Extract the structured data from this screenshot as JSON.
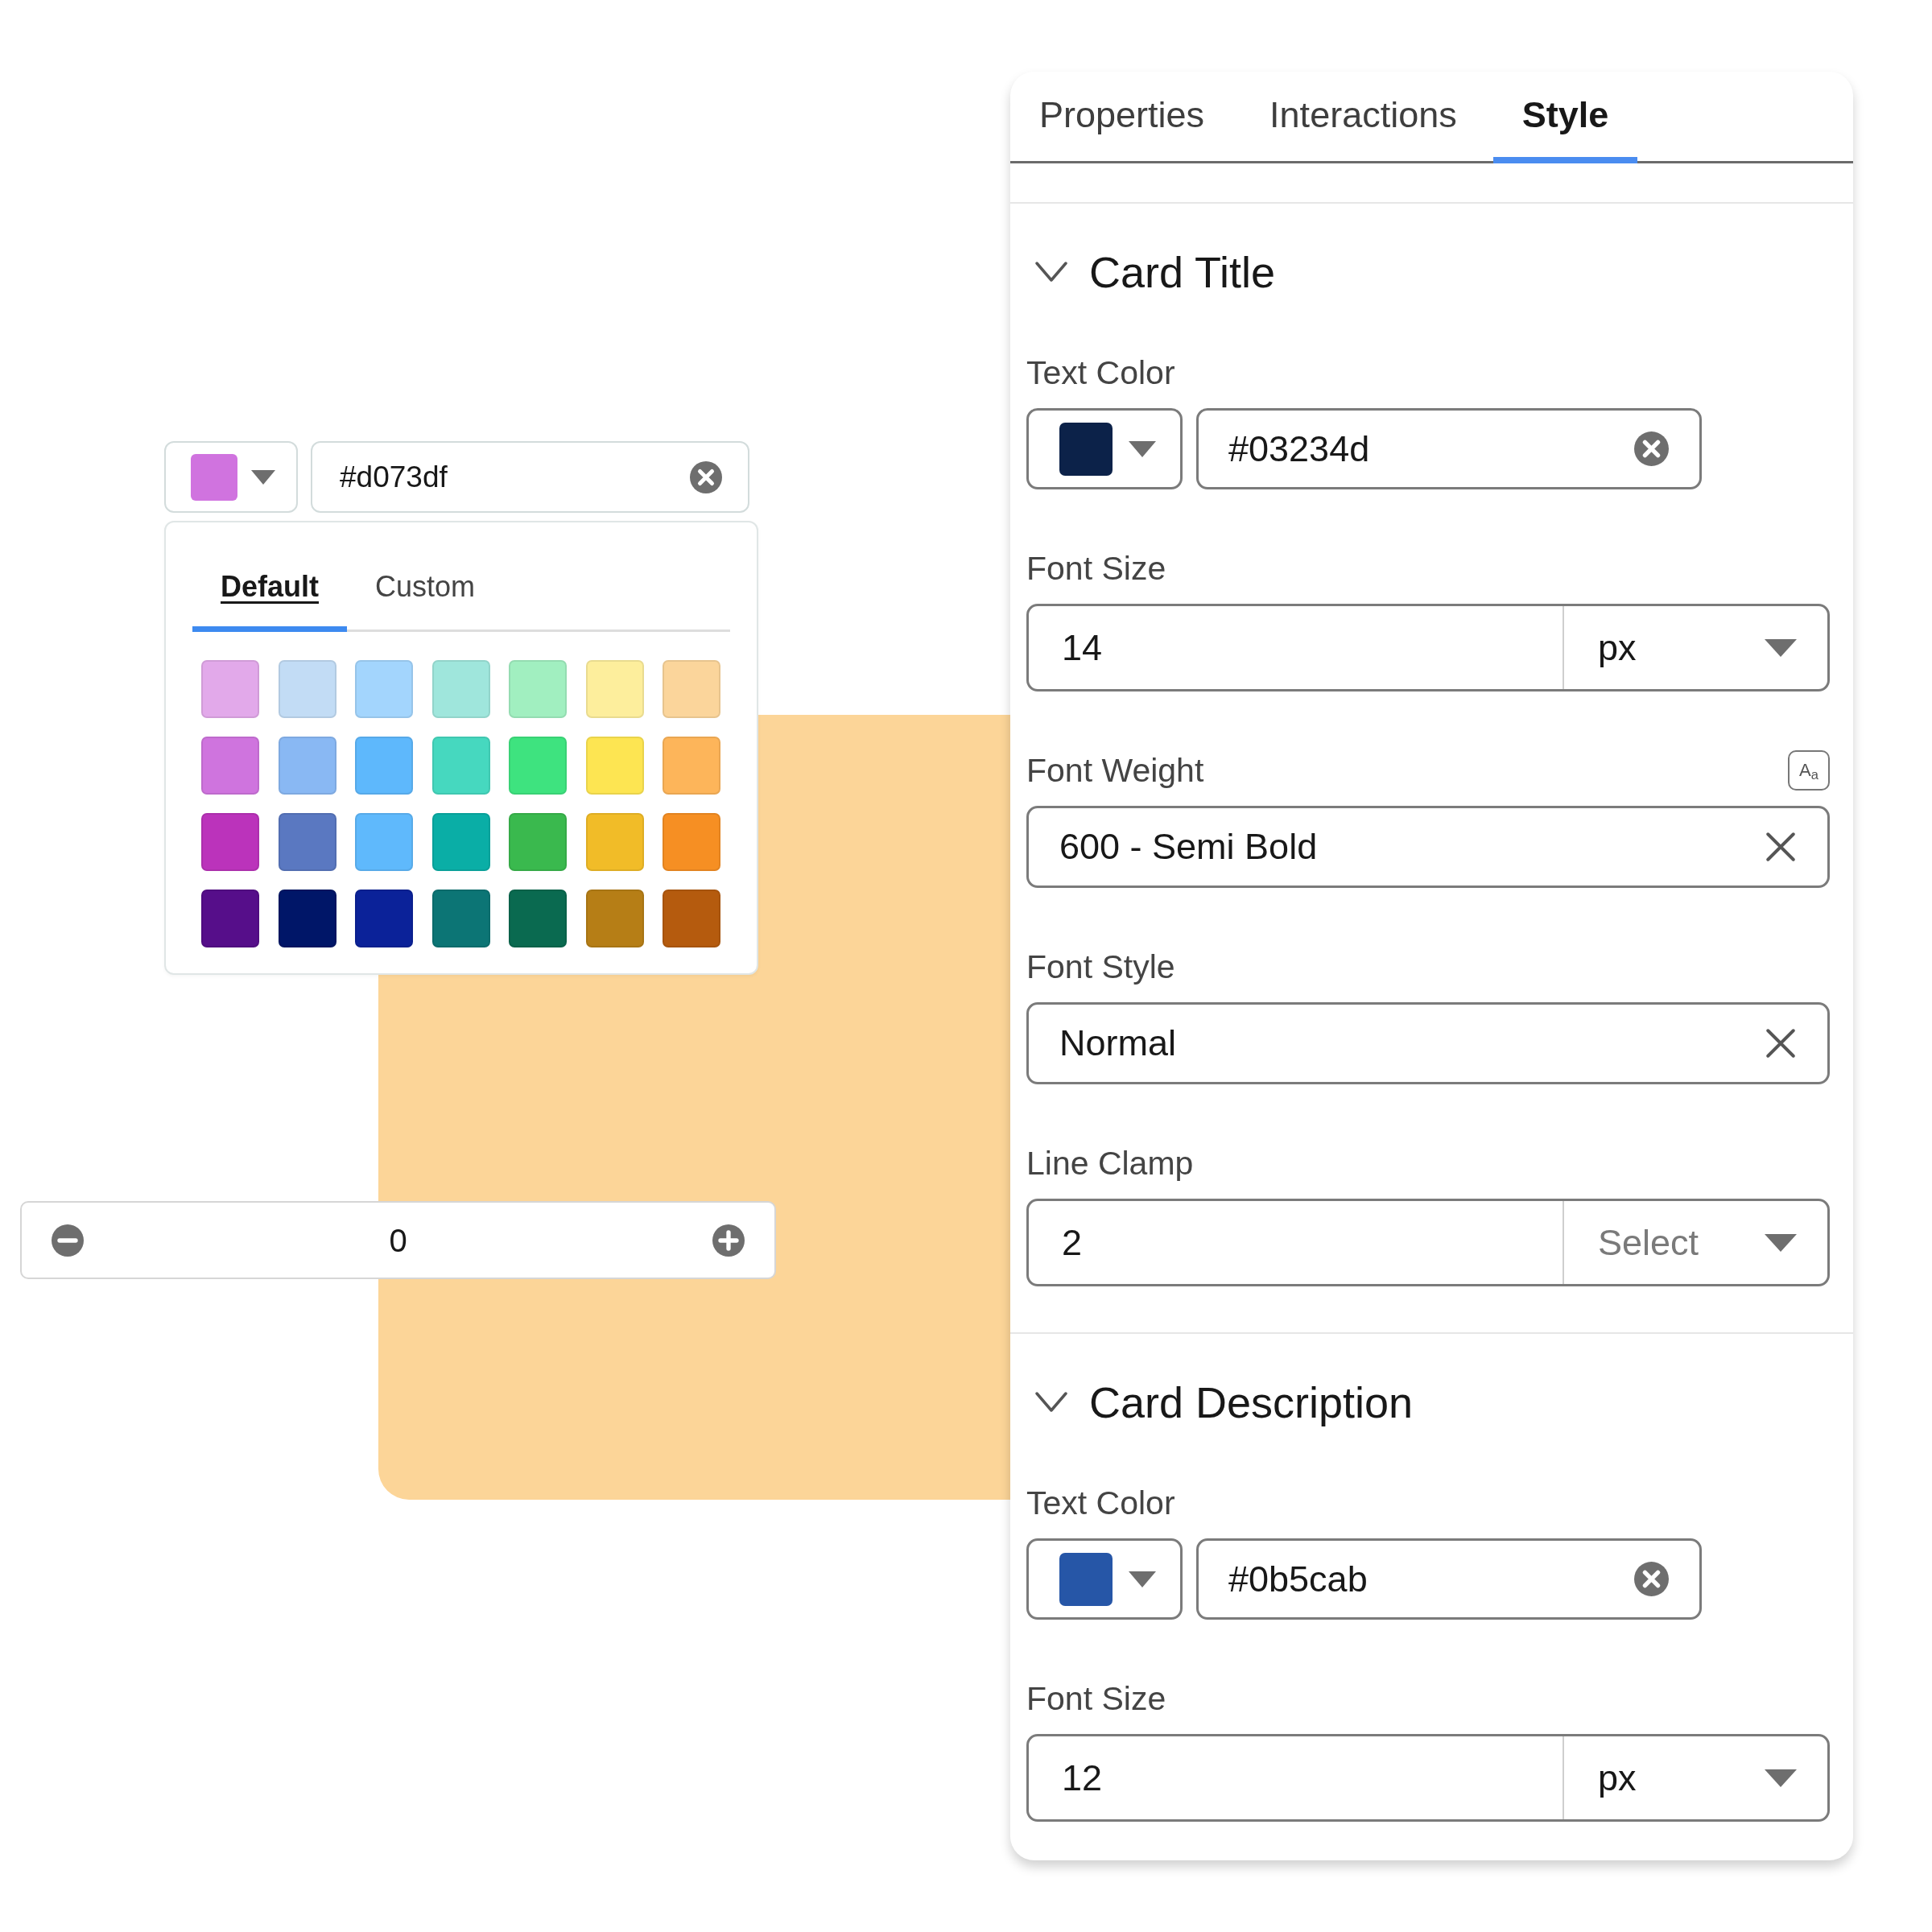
{
  "color_picker": {
    "color": "#d073df",
    "value": "#d073df",
    "tabs": [
      {
        "label": "Default",
        "selected": true
      },
      {
        "label": "Custom",
        "selected": false
      }
    ],
    "swatches": [
      {
        "color": "#e2a9ea"
      },
      {
        "color": "#c2dcf5"
      },
      {
        "color": "#a3d5fd"
      },
      {
        "color": "#9fe6dc"
      },
      {
        "color": "#a1efc0"
      },
      {
        "color": "#fdee9c"
      },
      {
        "color": "#fbd59b"
      },
      {
        "color": "#cf74de"
      },
      {
        "color": "#89b8f3"
      },
      {
        "color": "#5eb8fc"
      },
      {
        "color": "#46d8bf"
      },
      {
        "color": "#3ee37f"
      },
      {
        "color": "#fde552"
      },
      {
        "color": "#fdb55a"
      },
      {
        "color": "#bb33bb"
      },
      {
        "color": "#5a78c1"
      },
      {
        "color": "#5fb9fc"
      },
      {
        "color": "#0aaea6"
      },
      {
        "color": "#3ab94e"
      },
      {
        "color": "#f1bc28"
      },
      {
        "color": "#f68f23"
      },
      {
        "color": "#560e8a"
      },
      {
        "color": "#001668"
      },
      {
        "color": "#0b2299"
      },
      {
        "color": "#0c7575"
      },
      {
        "color": "#0a6a50"
      },
      {
        "color": "#b67e16"
      },
      {
        "color": "#b55b0e"
      }
    ]
  },
  "stepper": {
    "value": "0"
  },
  "panel": {
    "tabs": [
      {
        "label": "Properties",
        "selected": false
      },
      {
        "label": "Interactions",
        "selected": false
      },
      {
        "label": "Style",
        "selected": true
      }
    ],
    "sections": [
      {
        "title": "Card Title",
        "expanded": true,
        "fields": [
          {
            "kind": "color",
            "label": "Text Color",
            "color": "#0c2249",
            "value": "#03234d"
          },
          {
            "kind": "unit",
            "label": "Font Size",
            "value": "14",
            "unit": {
              "value": "px"
            }
          },
          {
            "kind": "select",
            "label": "Font Weight",
            "value": "600 - Semi Bold",
            "toggle": "A$_{a}$"
          },
          {
            "kind": "select",
            "label": "Font Style",
            "value": "Normal"
          },
          {
            "kind": "unit",
            "label": "Line Clamp",
            "value": "2",
            "unit": {
              "placeholder": "Select"
            }
          }
        ]
      },
      {
        "title": "Card Description",
        "expanded": true,
        "fields": [
          {
            "kind": "color",
            "label": "Text Color",
            "color": "#2656a7",
            "value": "#0b5cab"
          },
          {
            "kind": "unit",
            "label": "Font Size",
            "value": "12",
            "unit": {
              "value": "px"
            }
          }
        ]
      }
    ]
  }
}
